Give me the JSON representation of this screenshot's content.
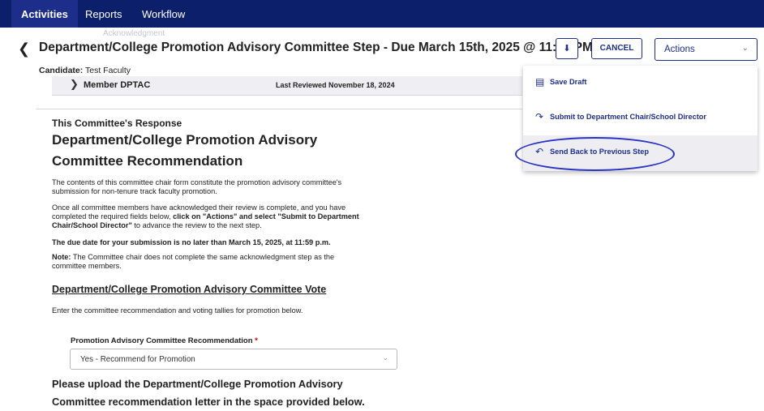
{
  "nav": {
    "items": [
      {
        "label": "Activities"
      },
      {
        "label": "Reports"
      },
      {
        "label": "Workflow"
      }
    ],
    "ghost_text": "Acknowledgment"
  },
  "header": {
    "title": "Department/College Promotion Advisory Committee Step - Due March 15th, 2025 @ 11:59 PM",
    "cancel_label": "CANCEL",
    "actions_label": "Actions",
    "icons": {
      "back": "chevron-left-icon",
      "download": "download-icon",
      "caret": "chevron-down-icon"
    }
  },
  "candidate": {
    "label": "Candidate:",
    "value": "Test Faculty"
  },
  "member": {
    "label": "Member DPTAC",
    "reviewed": "Last Reviewed November 18, 2024"
  },
  "content": {
    "section_label": "This Committee's Response",
    "heading": "Department/College Promotion Advisory Committee Recommendation",
    "p1": "The contents of this committee chair form constitute the promotion advisory committee's submission for non-tenure track faculty promotion.",
    "p2_a": "Once all committee members have acknowledged their review is complete, and you have completed the required fields below, ",
    "p2_b": "click on \"Actions\" and select \"Submit to Department Chair/School Director\"",
    "p2_c": " to advance the review to the next step.",
    "p3": "The due date for your submission is no later than March 15, 2025, at 11:59 p.m.",
    "note_label": "Note:",
    "note_text": " The Committee chair does not complete the same acknowledgment step as the committee members.",
    "vote_heading": "Department/College Promotion Advisory Committee Vote",
    "vote_desc": "Enter the committee recommendation and voting tallies for promotion below.",
    "field_label": "Promotion Advisory Committee Recommendation",
    "field_required": "*",
    "field_value": "Yes - Recommend for Promotion",
    "upload_heading": "Please upload the Department/College Promotion Advisory Committee recommendation letter in the space provided below."
  },
  "actions_menu": {
    "items": [
      {
        "label": "Save Draft",
        "icon": "save-icon"
      },
      {
        "label": "Submit to Department Chair/School Director",
        "icon": "forward-arrow-icon"
      },
      {
        "label": "Send Back to Previous Step",
        "icon": "back-arrow-icon"
      }
    ],
    "highlighted_index": 2
  },
  "colors": {
    "nav_bg": "#0b1f6b",
    "accent": "#1c2e8a",
    "annotation": "#2833c4"
  }
}
